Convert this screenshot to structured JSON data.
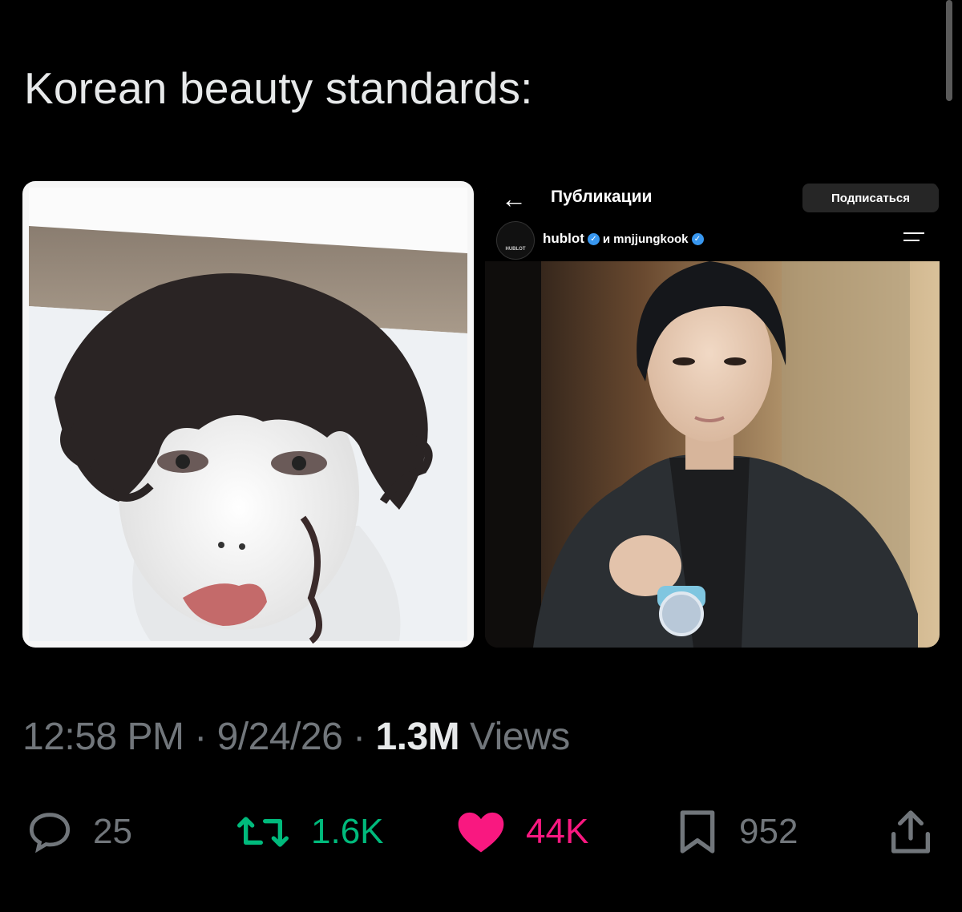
{
  "tweet": {
    "text": "Korean beauty standards:"
  },
  "media_right": {
    "header_title": "Публикации",
    "follow_button": "Подписаться",
    "account": "hublot",
    "collab_prefix": "и",
    "collab_account": "mnjjungkook",
    "avatar_text": "HUBLOT"
  },
  "meta": {
    "time": "12:58 PM",
    "date": "9/24/26",
    "views_count": "1.3M",
    "views_label": "Views",
    "separator": "·"
  },
  "actions": {
    "replies": "25",
    "reposts": "1.6K",
    "likes": "44K",
    "bookmarks": "952"
  },
  "colors": {
    "background": "#000000",
    "text": "#e7e9ea",
    "muted": "#71767b",
    "repost": "#00ba7c",
    "like": "#f91880",
    "verified": "#3897f0"
  },
  "icons": [
    "reply-icon",
    "repost-icon",
    "heart-icon",
    "bookmark-icon",
    "share-icon",
    "verified-icon",
    "back-arrow-icon",
    "menu-icon"
  ]
}
